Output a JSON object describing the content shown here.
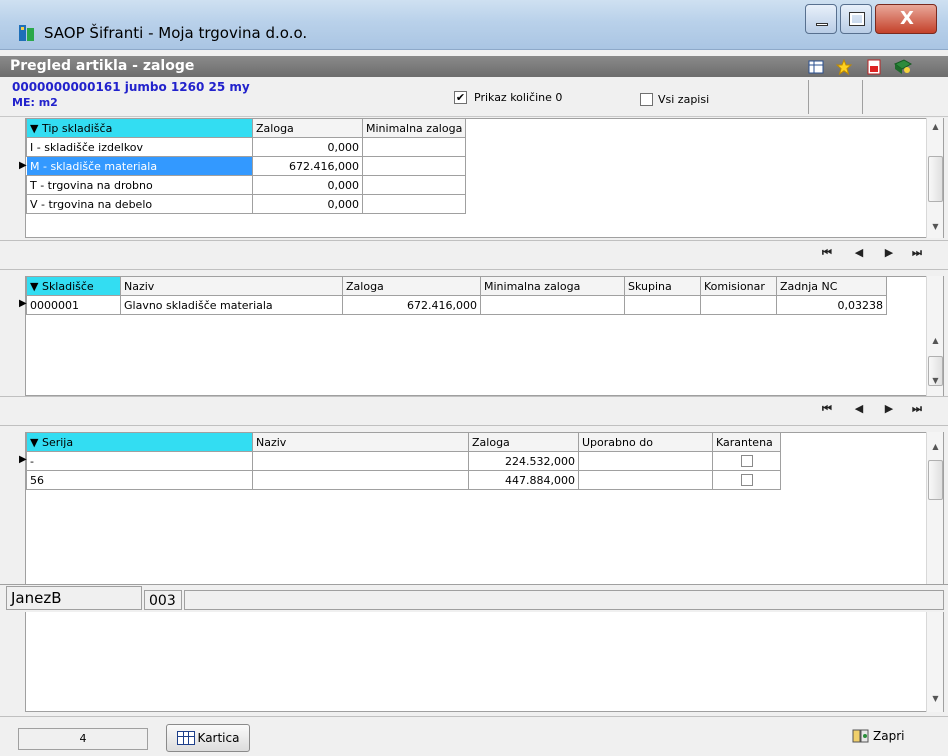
{
  "window": {
    "title": "SAOP Šifranti - Moja trgovina d.o.o."
  },
  "panel": {
    "title": "Pregled artikla - zaloge"
  },
  "article": {
    "code_line": "0000000000161 jumbo 1260 25 my",
    "me_line": "ME: m2"
  },
  "options": {
    "show_zero_label": "Prikaz količine 0",
    "show_zero_checked": true,
    "all_records_label": "Vsi zapisi",
    "all_records_checked": false
  },
  "grid1": {
    "headers": [
      "▼ Tip skladišča",
      "Zaloga",
      "Minimalna zaloga"
    ],
    "rows": [
      [
        "I - skladišče izdelkov",
        "0,000",
        ""
      ],
      [
        "M - skladišče materiala",
        "672.416,000",
        ""
      ],
      [
        "T - trgovina na drobno",
        "0,000",
        ""
      ],
      [
        "V - trgovina na debelo",
        "0,000",
        ""
      ]
    ],
    "selected_row": 1
  },
  "grid2": {
    "headers": [
      "▼ Skladišče",
      "Naziv",
      "Zaloga",
      "Minimalna zaloga",
      "Skupina",
      "Komisionar",
      "Zadnja NC"
    ],
    "rows": [
      [
        "0000001",
        "Glavno skladišče materiala",
        "672.416,000",
        "",
        "",
        "",
        "0,03238"
      ]
    ]
  },
  "grid3": {
    "headers": [
      "▼ Serija",
      "Naziv",
      "Zaloga",
      "Uporabno do",
      "Karantena"
    ],
    "rows": [
      [
        "-",
        "",
        "224.532,000",
        "",
        ""
      ],
      [
        "56",
        "",
        "447.884,000",
        "",
        ""
      ]
    ]
  },
  "navigation": {
    "first": "⏮",
    "prev": "◀",
    "next": "▶",
    "last": "⏭"
  },
  "footer": {
    "count": "4",
    "card_button": "Kartica",
    "close_button": "Zapri"
  },
  "statusbar": {
    "user": "JanezB",
    "code": "003"
  },
  "colors": {
    "sorted_header": "#33ddf2",
    "selection": "#3399ff",
    "article_text": "#2222cc"
  }
}
